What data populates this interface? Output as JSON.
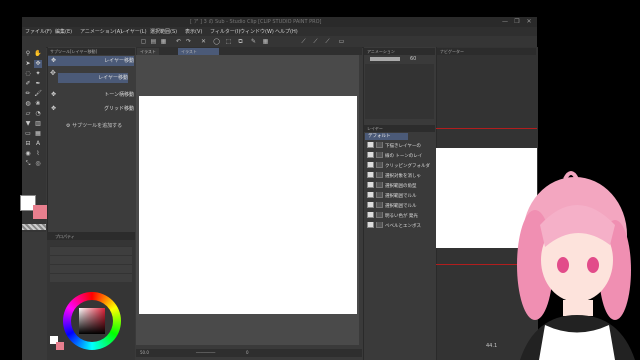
{
  "title": "[ ア ] 3 の Sub - Studio Clip [CLIP STUDIO PAINT PRO]",
  "window_controls": [
    "—",
    "❐",
    "✕"
  ],
  "menu": [
    "ファイル(F)",
    "編集(E)",
    "アニメーション(A)",
    "レイヤー(L)",
    "選択範囲(S)",
    "表示(V)",
    "フィルター(I)",
    "ウィンドウ(W)",
    "ヘルプ(H)"
  ],
  "subtool_panel": {
    "tab_label": "サブツール[レイヤー移動]",
    "items": [
      {
        "label": "レイヤー移動",
        "selected": true
      },
      {
        "label": "レイヤー移動",
        "selected": true
      },
      {
        "label": "トーン柄移動",
        "selected": false
      },
      {
        "label": "グリッド移動",
        "selected": false
      }
    ],
    "add_label": "サブツールを追加する"
  },
  "property_panel": {
    "tab_label": "プロパティ"
  },
  "doc_tabs": [
    "イラスト",
    "イラスト"
  ],
  "status": {
    "zoom": "50.0",
    "position": "0"
  },
  "animation_panel": {
    "tab_label": "アニメーション",
    "frame": "60"
  },
  "layer_panel": {
    "tab_label": "レイヤー",
    "folder_label": "デフォルト",
    "layers": [
      {
        "name": "下描きレイヤーの",
        "checked": true
      },
      {
        "name": "線の トーンのレイ",
        "checked": true
      },
      {
        "name": "クリッピングフォルダ",
        "checked": true
      },
      {
        "name": "選択対象を消しゃ",
        "checked": true
      },
      {
        "name": "選択範囲の角型",
        "checked": true
      },
      {
        "name": "選択範囲でルル",
        "checked": true
      },
      {
        "name": "選択範囲でルル",
        "checked": true
      },
      {
        "name": "明るい色が 発光",
        "checked": true
      },
      {
        "name": "ベベルとエンボス",
        "checked": true
      }
    ]
  },
  "navigator": {
    "tab_label": "ナビゲーター",
    "zoom": "44.1"
  },
  "colors": {
    "main": "#ffffff",
    "sub": "#e87f8e",
    "accent": "#4b5a78",
    "canvas": "#ffffff",
    "red_guides": "#b21e1e"
  }
}
